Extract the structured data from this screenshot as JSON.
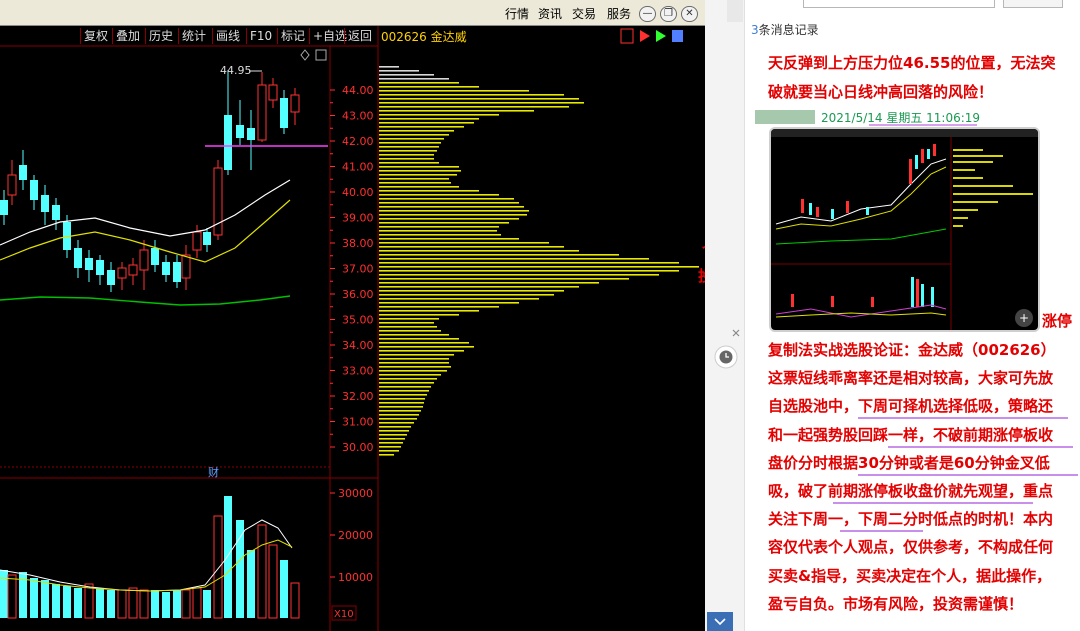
{
  "topbar": {
    "buttons": [
      "行情",
      "资讯",
      "交易",
      "服务"
    ]
  },
  "toolbar": {
    "buttons": [
      "复权",
      "叠加",
      "历史",
      "统计",
      "画线",
      "F10",
      "标记",
      "+自选",
      "返回"
    ]
  },
  "stock": {
    "code_name": "002626 金达威",
    "high_label": "44.95"
  },
  "price_axis": [
    "44.00",
    "43.00",
    "42.00",
    "41.00",
    "40.00",
    "39.00",
    "38.00",
    "37.00",
    "36.00",
    "35.00",
    "34.00",
    "33.00",
    "32.00",
    "31.00",
    "30.00"
  ],
  "volume_axis": [
    "30000",
    "20000",
    "10000"
  ],
  "volume_unit": "X10",
  "cai_label": "财",
  "side_fragments": [
    "个人",
    "投资"
  ],
  "chat": {
    "message_count_prefix": "3",
    "message_count_suffix": "条消息记录",
    "headline_line1": "天反弹到上方压力位46.55的位置，无法突",
    "headline_line2": "破就要当心日线冲高回落的风险！",
    "sender_time": "2021/5/14 星期五 11:06:19",
    "tail_label": "涨停",
    "body_lines": [
      "复制法实战选股论证：金达威（002626）",
      "这票短线乖离率还是相对较高，大家可先放",
      "自选股池中，下周可择机选择低吸，策略还",
      "和一起强势股回踩一样，不破前期涨停板收",
      "盘价分时根据30分钟或者是60分钟金叉低",
      "吸，破了前期涨停板收盘价就先观望，重点",
      "关注下周一，下周二分时低点的时机！本内",
      "容仅代表个人观点，仅供参考，不构成任何",
      "买卖&指导，买卖决定在个人，据此操作，",
      "盈亏自负。市场有风险，投资需谨慎！"
    ]
  },
  "colors": {
    "up": "#ff3232",
    "down": "#54ffff",
    "profile": "#e8e800",
    "ma_white": "#ffffff",
    "ma_yellow": "#e0e000",
    "ma_green": "#00c000",
    "text_red": "#e40000"
  },
  "icons": [
    "clock-icon",
    "zoom-in-icon",
    "close-icon",
    "chevron-down-icon"
  ]
}
